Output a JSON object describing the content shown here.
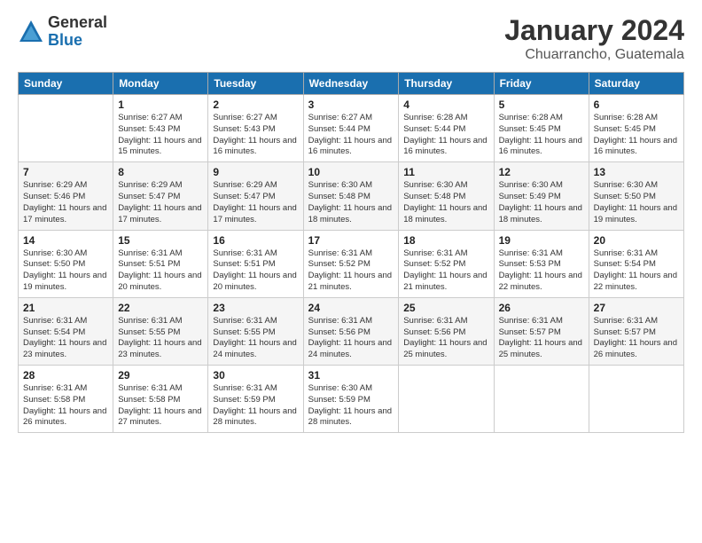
{
  "logo": {
    "general": "General",
    "blue": "Blue"
  },
  "title": "January 2024",
  "location": "Chuarrancho, Guatemala",
  "days_of_week": [
    "Sunday",
    "Monday",
    "Tuesday",
    "Wednesday",
    "Thursday",
    "Friday",
    "Saturday"
  ],
  "weeks": [
    [
      {
        "day": "",
        "sunrise": "",
        "sunset": "",
        "daylight": ""
      },
      {
        "day": "1",
        "sunrise": "Sunrise: 6:27 AM",
        "sunset": "Sunset: 5:43 PM",
        "daylight": "Daylight: 11 hours and 15 minutes."
      },
      {
        "day": "2",
        "sunrise": "Sunrise: 6:27 AM",
        "sunset": "Sunset: 5:43 PM",
        "daylight": "Daylight: 11 hours and 16 minutes."
      },
      {
        "day": "3",
        "sunrise": "Sunrise: 6:27 AM",
        "sunset": "Sunset: 5:44 PM",
        "daylight": "Daylight: 11 hours and 16 minutes."
      },
      {
        "day": "4",
        "sunrise": "Sunrise: 6:28 AM",
        "sunset": "Sunset: 5:44 PM",
        "daylight": "Daylight: 11 hours and 16 minutes."
      },
      {
        "day": "5",
        "sunrise": "Sunrise: 6:28 AM",
        "sunset": "Sunset: 5:45 PM",
        "daylight": "Daylight: 11 hours and 16 minutes."
      },
      {
        "day": "6",
        "sunrise": "Sunrise: 6:28 AM",
        "sunset": "Sunset: 5:45 PM",
        "daylight": "Daylight: 11 hours and 16 minutes."
      }
    ],
    [
      {
        "day": "7",
        "sunrise": "Sunrise: 6:29 AM",
        "sunset": "Sunset: 5:46 PM",
        "daylight": "Daylight: 11 hours and 17 minutes."
      },
      {
        "day": "8",
        "sunrise": "Sunrise: 6:29 AM",
        "sunset": "Sunset: 5:47 PM",
        "daylight": "Daylight: 11 hours and 17 minutes."
      },
      {
        "day": "9",
        "sunrise": "Sunrise: 6:29 AM",
        "sunset": "Sunset: 5:47 PM",
        "daylight": "Daylight: 11 hours and 17 minutes."
      },
      {
        "day": "10",
        "sunrise": "Sunrise: 6:30 AM",
        "sunset": "Sunset: 5:48 PM",
        "daylight": "Daylight: 11 hours and 18 minutes."
      },
      {
        "day": "11",
        "sunrise": "Sunrise: 6:30 AM",
        "sunset": "Sunset: 5:48 PM",
        "daylight": "Daylight: 11 hours and 18 minutes."
      },
      {
        "day": "12",
        "sunrise": "Sunrise: 6:30 AM",
        "sunset": "Sunset: 5:49 PM",
        "daylight": "Daylight: 11 hours and 18 minutes."
      },
      {
        "day": "13",
        "sunrise": "Sunrise: 6:30 AM",
        "sunset": "Sunset: 5:50 PM",
        "daylight": "Daylight: 11 hours and 19 minutes."
      }
    ],
    [
      {
        "day": "14",
        "sunrise": "Sunrise: 6:30 AM",
        "sunset": "Sunset: 5:50 PM",
        "daylight": "Daylight: 11 hours and 19 minutes."
      },
      {
        "day": "15",
        "sunrise": "Sunrise: 6:31 AM",
        "sunset": "Sunset: 5:51 PM",
        "daylight": "Daylight: 11 hours and 20 minutes."
      },
      {
        "day": "16",
        "sunrise": "Sunrise: 6:31 AM",
        "sunset": "Sunset: 5:51 PM",
        "daylight": "Daylight: 11 hours and 20 minutes."
      },
      {
        "day": "17",
        "sunrise": "Sunrise: 6:31 AM",
        "sunset": "Sunset: 5:52 PM",
        "daylight": "Daylight: 11 hours and 21 minutes."
      },
      {
        "day": "18",
        "sunrise": "Sunrise: 6:31 AM",
        "sunset": "Sunset: 5:52 PM",
        "daylight": "Daylight: 11 hours and 21 minutes."
      },
      {
        "day": "19",
        "sunrise": "Sunrise: 6:31 AM",
        "sunset": "Sunset: 5:53 PM",
        "daylight": "Daylight: 11 hours and 22 minutes."
      },
      {
        "day": "20",
        "sunrise": "Sunrise: 6:31 AM",
        "sunset": "Sunset: 5:54 PM",
        "daylight": "Daylight: 11 hours and 22 minutes."
      }
    ],
    [
      {
        "day": "21",
        "sunrise": "Sunrise: 6:31 AM",
        "sunset": "Sunset: 5:54 PM",
        "daylight": "Daylight: 11 hours and 23 minutes."
      },
      {
        "day": "22",
        "sunrise": "Sunrise: 6:31 AM",
        "sunset": "Sunset: 5:55 PM",
        "daylight": "Daylight: 11 hours and 23 minutes."
      },
      {
        "day": "23",
        "sunrise": "Sunrise: 6:31 AM",
        "sunset": "Sunset: 5:55 PM",
        "daylight": "Daylight: 11 hours and 24 minutes."
      },
      {
        "day": "24",
        "sunrise": "Sunrise: 6:31 AM",
        "sunset": "Sunset: 5:56 PM",
        "daylight": "Daylight: 11 hours and 24 minutes."
      },
      {
        "day": "25",
        "sunrise": "Sunrise: 6:31 AM",
        "sunset": "Sunset: 5:56 PM",
        "daylight": "Daylight: 11 hours and 25 minutes."
      },
      {
        "day": "26",
        "sunrise": "Sunrise: 6:31 AM",
        "sunset": "Sunset: 5:57 PM",
        "daylight": "Daylight: 11 hours and 25 minutes."
      },
      {
        "day": "27",
        "sunrise": "Sunrise: 6:31 AM",
        "sunset": "Sunset: 5:57 PM",
        "daylight": "Daylight: 11 hours and 26 minutes."
      }
    ],
    [
      {
        "day": "28",
        "sunrise": "Sunrise: 6:31 AM",
        "sunset": "Sunset: 5:58 PM",
        "daylight": "Daylight: 11 hours and 26 minutes."
      },
      {
        "day": "29",
        "sunrise": "Sunrise: 6:31 AM",
        "sunset": "Sunset: 5:58 PM",
        "daylight": "Daylight: 11 hours and 27 minutes."
      },
      {
        "day": "30",
        "sunrise": "Sunrise: 6:31 AM",
        "sunset": "Sunset: 5:59 PM",
        "daylight": "Daylight: 11 hours and 28 minutes."
      },
      {
        "day": "31",
        "sunrise": "Sunrise: 6:30 AM",
        "sunset": "Sunset: 5:59 PM",
        "daylight": "Daylight: 11 hours and 28 minutes."
      },
      {
        "day": "",
        "sunrise": "",
        "sunset": "",
        "daylight": ""
      },
      {
        "day": "",
        "sunrise": "",
        "sunset": "",
        "daylight": ""
      },
      {
        "day": "",
        "sunrise": "",
        "sunset": "",
        "daylight": ""
      }
    ]
  ]
}
